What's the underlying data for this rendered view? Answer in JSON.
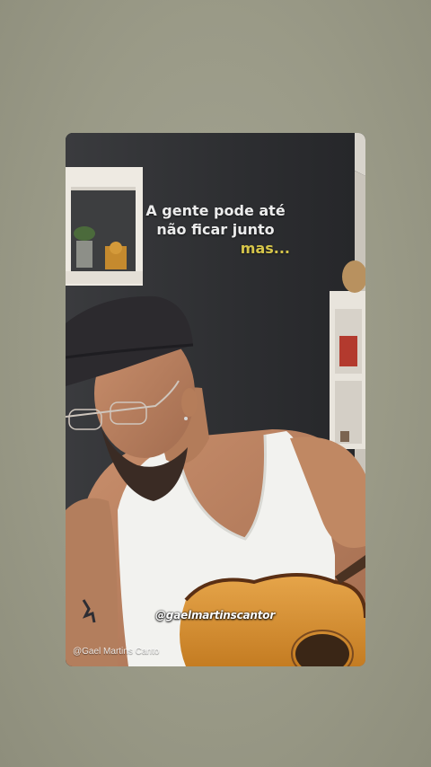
{
  "lyrics": {
    "line1": "A gente pode até",
    "line2": "não ficar junto",
    "line3": "mas..."
  },
  "sticker": {
    "handle": "@gaelmartinscantor"
  },
  "watermark": {
    "text": "@Gael Martins Canto"
  },
  "colors": {
    "background": "#9c9c8a",
    "lyric_text": "#ececec",
    "lyric_accent": "#d6c54a"
  }
}
